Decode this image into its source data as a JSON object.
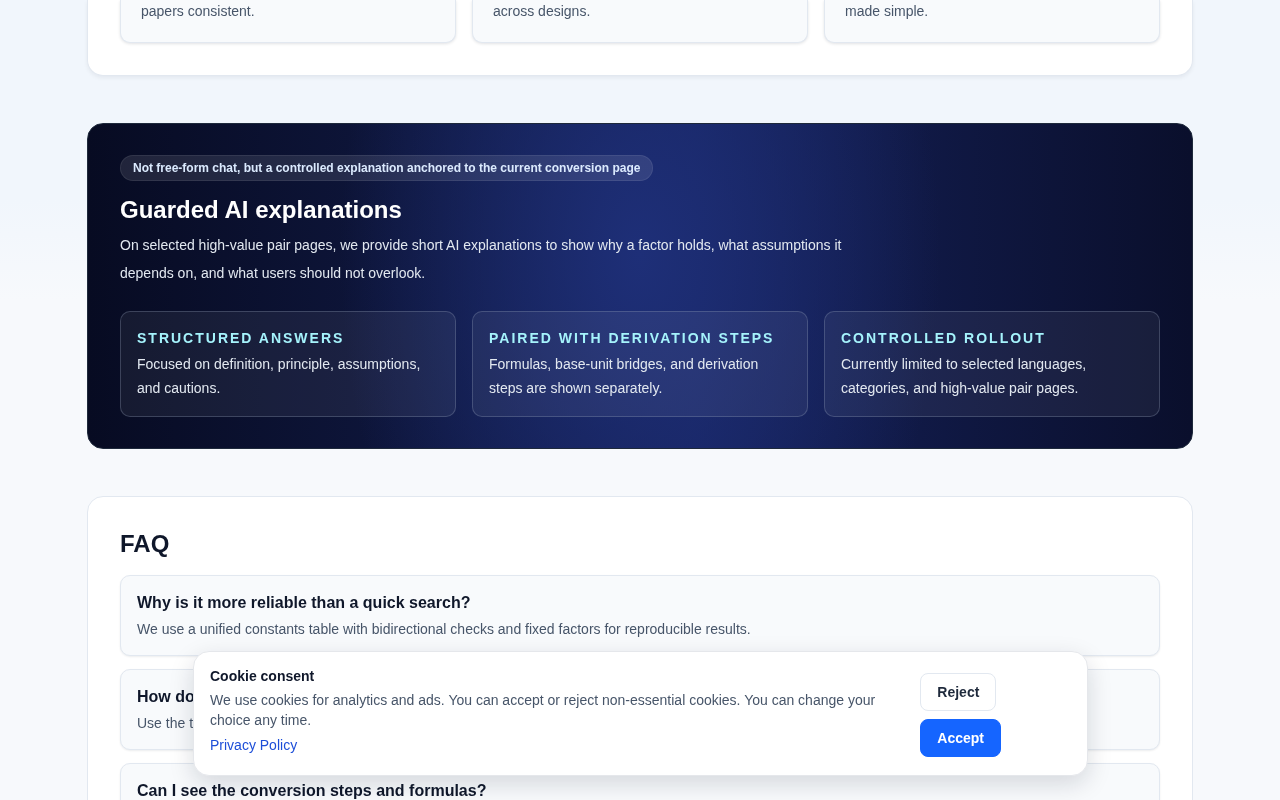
{
  "intro_cards": [
    {
      "text": "papers consistent."
    },
    {
      "text": "across designs."
    },
    {
      "text": "made simple."
    }
  ],
  "ai_section": {
    "badge": "Not free-form chat, but a controlled explanation anchored to the current conversion page",
    "title": "Guarded AI explanations",
    "description": "On selected high-value pair pages, we provide short AI explanations to show why a factor holds, what assumptions it depends on, and what users should not overlook.",
    "features": [
      {
        "title": "STRUCTURED ANSWERS",
        "text": "Focused on definition, principle, assumptions, and cautions."
      },
      {
        "title": "PAIRED WITH DERIVATION STEPS",
        "text": "Formulas, base-unit bridges, and derivation steps are shown separately."
      },
      {
        "title": "CONTROLLED ROLLOUT",
        "text": "Currently limited to selected languages, categories, and high-value pair pages."
      }
    ]
  },
  "faq": {
    "title": "FAQ",
    "items": [
      {
        "question": "Why is it more reliable than a quick search?",
        "answer": "We use a unified constants table with bidirectional checks and fixed factors for reproducible results."
      },
      {
        "question": "How do",
        "answer": "Use the t"
      },
      {
        "question": "Can I see the conversion steps and formulas?"
      }
    ]
  },
  "cookie_banner": {
    "title": "Cookie consent",
    "text": "We use cookies for analytics and ads. You can accept or reject non-essential cookies. You can change your choice any time.",
    "link": "Privacy Policy",
    "buttons": [
      {
        "label": "Reject",
        "kind": "secondary"
      },
      {
        "label": "Accept",
        "kind": "primary"
      }
    ]
  }
}
